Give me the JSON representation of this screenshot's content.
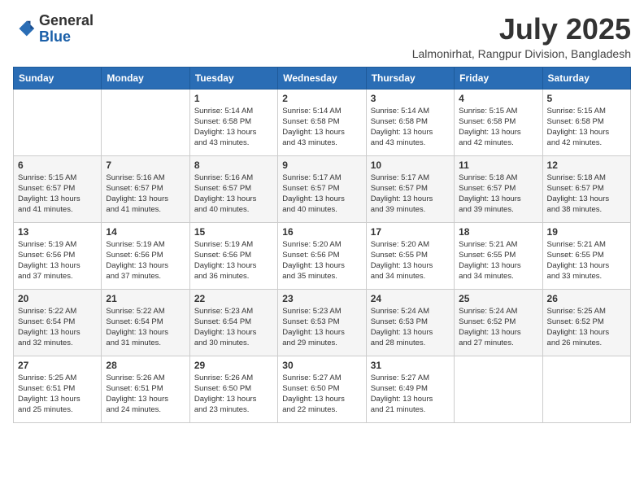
{
  "header": {
    "logo_line1": "General",
    "logo_line2": "Blue",
    "month_title": "July 2025",
    "location": "Lalmonirhat, Rangpur Division, Bangladesh"
  },
  "weekdays": [
    "Sunday",
    "Monday",
    "Tuesday",
    "Wednesday",
    "Thursday",
    "Friday",
    "Saturday"
  ],
  "weeks": [
    [
      {
        "day": "",
        "info": ""
      },
      {
        "day": "",
        "info": ""
      },
      {
        "day": "1",
        "info": "Sunrise: 5:14 AM\nSunset: 6:58 PM\nDaylight: 13 hours\nand 43 minutes."
      },
      {
        "day": "2",
        "info": "Sunrise: 5:14 AM\nSunset: 6:58 PM\nDaylight: 13 hours\nand 43 minutes."
      },
      {
        "day": "3",
        "info": "Sunrise: 5:14 AM\nSunset: 6:58 PM\nDaylight: 13 hours\nand 43 minutes."
      },
      {
        "day": "4",
        "info": "Sunrise: 5:15 AM\nSunset: 6:58 PM\nDaylight: 13 hours\nand 42 minutes."
      },
      {
        "day": "5",
        "info": "Sunrise: 5:15 AM\nSunset: 6:58 PM\nDaylight: 13 hours\nand 42 minutes."
      }
    ],
    [
      {
        "day": "6",
        "info": "Sunrise: 5:15 AM\nSunset: 6:57 PM\nDaylight: 13 hours\nand 41 minutes."
      },
      {
        "day": "7",
        "info": "Sunrise: 5:16 AM\nSunset: 6:57 PM\nDaylight: 13 hours\nand 41 minutes."
      },
      {
        "day": "8",
        "info": "Sunrise: 5:16 AM\nSunset: 6:57 PM\nDaylight: 13 hours\nand 40 minutes."
      },
      {
        "day": "9",
        "info": "Sunrise: 5:17 AM\nSunset: 6:57 PM\nDaylight: 13 hours\nand 40 minutes."
      },
      {
        "day": "10",
        "info": "Sunrise: 5:17 AM\nSunset: 6:57 PM\nDaylight: 13 hours\nand 39 minutes."
      },
      {
        "day": "11",
        "info": "Sunrise: 5:18 AM\nSunset: 6:57 PM\nDaylight: 13 hours\nand 39 minutes."
      },
      {
        "day": "12",
        "info": "Sunrise: 5:18 AM\nSunset: 6:57 PM\nDaylight: 13 hours\nand 38 minutes."
      }
    ],
    [
      {
        "day": "13",
        "info": "Sunrise: 5:19 AM\nSunset: 6:56 PM\nDaylight: 13 hours\nand 37 minutes."
      },
      {
        "day": "14",
        "info": "Sunrise: 5:19 AM\nSunset: 6:56 PM\nDaylight: 13 hours\nand 37 minutes."
      },
      {
        "day": "15",
        "info": "Sunrise: 5:19 AM\nSunset: 6:56 PM\nDaylight: 13 hours\nand 36 minutes."
      },
      {
        "day": "16",
        "info": "Sunrise: 5:20 AM\nSunset: 6:56 PM\nDaylight: 13 hours\nand 35 minutes."
      },
      {
        "day": "17",
        "info": "Sunrise: 5:20 AM\nSunset: 6:55 PM\nDaylight: 13 hours\nand 34 minutes."
      },
      {
        "day": "18",
        "info": "Sunrise: 5:21 AM\nSunset: 6:55 PM\nDaylight: 13 hours\nand 34 minutes."
      },
      {
        "day": "19",
        "info": "Sunrise: 5:21 AM\nSunset: 6:55 PM\nDaylight: 13 hours\nand 33 minutes."
      }
    ],
    [
      {
        "day": "20",
        "info": "Sunrise: 5:22 AM\nSunset: 6:54 PM\nDaylight: 13 hours\nand 32 minutes."
      },
      {
        "day": "21",
        "info": "Sunrise: 5:22 AM\nSunset: 6:54 PM\nDaylight: 13 hours\nand 31 minutes."
      },
      {
        "day": "22",
        "info": "Sunrise: 5:23 AM\nSunset: 6:54 PM\nDaylight: 13 hours\nand 30 minutes."
      },
      {
        "day": "23",
        "info": "Sunrise: 5:23 AM\nSunset: 6:53 PM\nDaylight: 13 hours\nand 29 minutes."
      },
      {
        "day": "24",
        "info": "Sunrise: 5:24 AM\nSunset: 6:53 PM\nDaylight: 13 hours\nand 28 minutes."
      },
      {
        "day": "25",
        "info": "Sunrise: 5:24 AM\nSunset: 6:52 PM\nDaylight: 13 hours\nand 27 minutes."
      },
      {
        "day": "26",
        "info": "Sunrise: 5:25 AM\nSunset: 6:52 PM\nDaylight: 13 hours\nand 26 minutes."
      }
    ],
    [
      {
        "day": "27",
        "info": "Sunrise: 5:25 AM\nSunset: 6:51 PM\nDaylight: 13 hours\nand 25 minutes."
      },
      {
        "day": "28",
        "info": "Sunrise: 5:26 AM\nSunset: 6:51 PM\nDaylight: 13 hours\nand 24 minutes."
      },
      {
        "day": "29",
        "info": "Sunrise: 5:26 AM\nSunset: 6:50 PM\nDaylight: 13 hours\nand 23 minutes."
      },
      {
        "day": "30",
        "info": "Sunrise: 5:27 AM\nSunset: 6:50 PM\nDaylight: 13 hours\nand 22 minutes."
      },
      {
        "day": "31",
        "info": "Sunrise: 5:27 AM\nSunset: 6:49 PM\nDaylight: 13 hours\nand 21 minutes."
      },
      {
        "day": "",
        "info": ""
      },
      {
        "day": "",
        "info": ""
      }
    ]
  ]
}
